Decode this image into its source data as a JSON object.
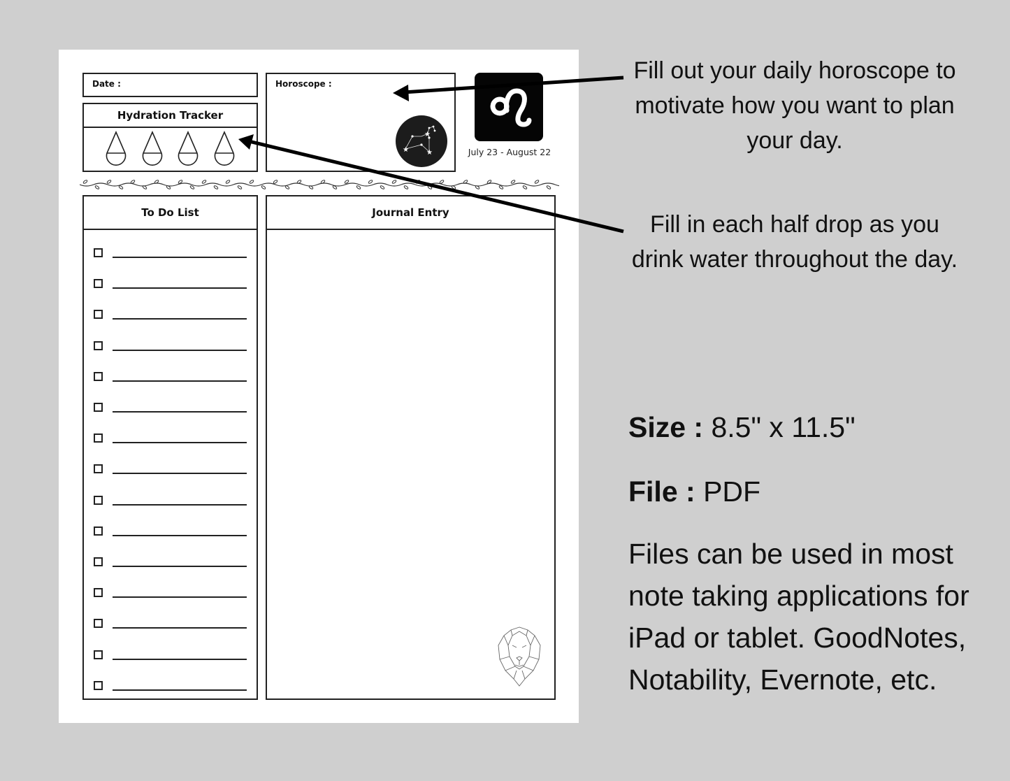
{
  "planner": {
    "date_label": "Date :",
    "hydration_title": "Hydration Tracker",
    "hydration_drops": 4,
    "horoscope_label": "Horoscope :",
    "zodiac_sign": "Leo",
    "zodiac_symbol": "♌",
    "zodiac_dates": "July 23 - August 22",
    "todo_title": "To Do List",
    "todo_items": [
      "",
      "",
      "",
      "",
      "",
      "",
      "",
      "",
      "",
      "",
      "",
      "",
      "",
      "",
      ""
    ],
    "journal_title": "Journal Entry"
  },
  "annotations": {
    "horoscope_note": "Fill out your daily horoscope to motivate how you want to plan your day.",
    "hydration_note": "Fill in each half drop as you drink water throughout the day."
  },
  "specs": {
    "size_label": "Size :",
    "size_value": " 8.5\" x 11.5\"",
    "file_label": "File :",
    "file_value": " PDF",
    "description": "Files can be used in most note taking applications for iPad or tablet. GoodNotes, Notability, Evernote, etc."
  },
  "colors": {
    "background": "#cfcfcf",
    "sheet": "#ffffff",
    "ink": "#111111"
  }
}
